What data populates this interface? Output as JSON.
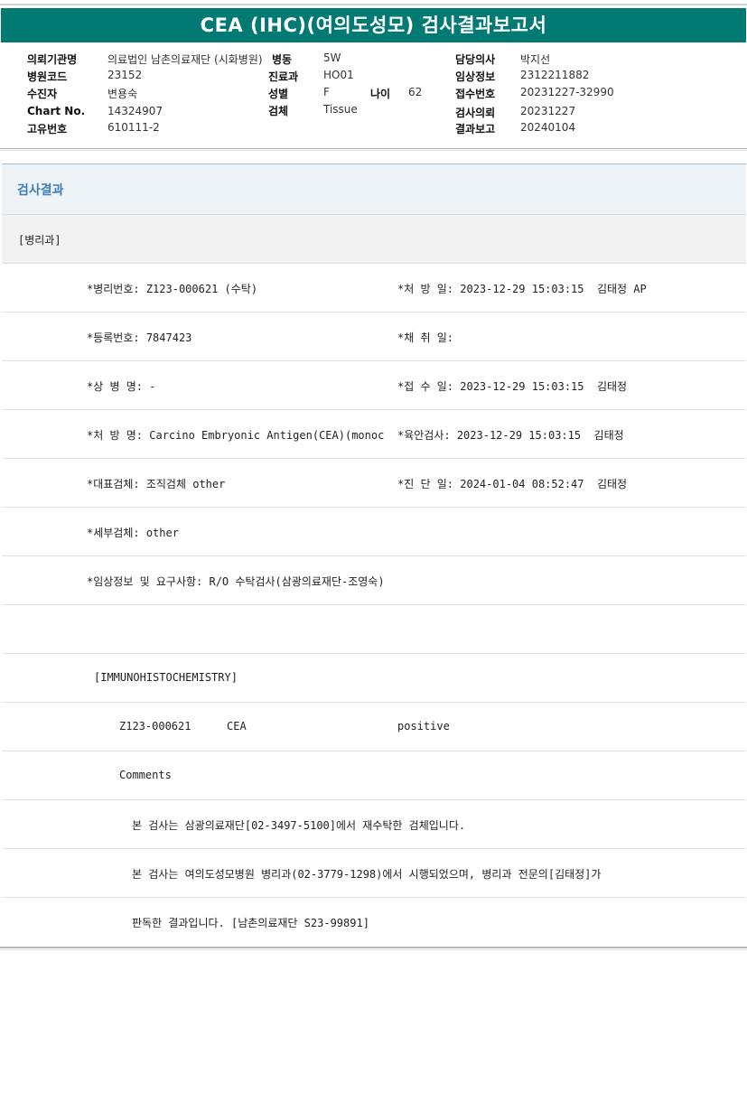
{
  "report": {
    "title": "CEA (IHC)(여의도성모) 검사결과보고서"
  },
  "info": {
    "institution_label": "의뢰기관명",
    "institution": "의료법인 남촌의료재단 (시화병원)",
    "ward_label": "병동",
    "ward": "5W",
    "doctor_label": "담당의사",
    "doctor": "박지선",
    "hospital_code_label": "병원코드",
    "hospital_code": "23152",
    "dept_label": "진료과",
    "dept": "HO01",
    "clinical_label": "임상정보",
    "clinical": "2312211882",
    "patient_label": "수진자",
    "patient": "변용숙",
    "sex_label": "성별",
    "sex": "F",
    "age_label": "나이",
    "age": "62",
    "receipt_label": "접수번호",
    "receipt": "20231227-32990",
    "chart_label": "Chart No.",
    "chart": "14324907",
    "specimen_label": "검체",
    "specimen": "Tissue",
    "request_label": "검사의뢰",
    "request_date": "20231227",
    "unique_label": "고유번호",
    "unique": "610111-2",
    "report_label": "결과보고",
    "report_date": "20240104"
  },
  "results": {
    "heading": "검사결과",
    "department": "[병리과]",
    "rows": [
      {
        "left": "*병리번호: Z123-000621 (수탁)",
        "right": "*처 방 일: 2023-12-29 15:03:15  김태정 AP"
      },
      {
        "left": "*등록번호: 7847423",
        "right": "*채 취 일:"
      },
      {
        "left": "*상 병 명: -",
        "right": "*접 수 일: 2023-12-29 15:03:15  김태정"
      },
      {
        "left": "*처 방 명: Carcino Embryonic Antigen(CEA)(monoc",
        "right": "*육안검사: 2023-12-29 15:03:15  김태정"
      },
      {
        "left": "*대표검체: 조직검체 other",
        "right": "*진 단 일: 2024-01-04 08:52:47  김태정"
      },
      {
        "left": "*세부검체: other",
        "right": ""
      },
      {
        "left": "*임상정보 및 요구사항: R/O 수탁검사(삼광의료재단-조영숙)",
        "right": ""
      }
    ],
    "ihc_header": "[IMMUNOHISTOCHEMISTRY]",
    "ihc_case": "Z123-000621",
    "ihc_marker": "CEA",
    "ihc_result": "positive",
    "comments_label": "Comments",
    "comments": [
      "본 검사는 삼광의료재단[02-3497-5100]에서 재수탁한 검체입니다.",
      "본 검사는 여의도성모병원 병리과(02-3779-1298)에서 시행되었으며, 병리과 전문의[김태정]가",
      "판독한 결과입니다. [남촌의료재단 S23-99891]"
    ]
  }
}
